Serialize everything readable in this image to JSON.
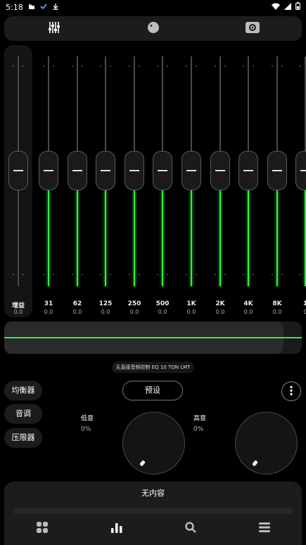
{
  "status_bar": {
    "time": "5:18"
  },
  "gain": {
    "label": "增益",
    "value": "0.0"
  },
  "bands": [
    {
      "freq": "31",
      "value": "0.0"
    },
    {
      "freq": "62",
      "value": "0.0"
    },
    {
      "freq": "125",
      "value": "0.0"
    },
    {
      "freq": "250",
      "value": "0.0"
    },
    {
      "freq": "500",
      "value": "0.0"
    },
    {
      "freq": "1K",
      "value": "0.0"
    },
    {
      "freq": "2K",
      "value": "0.0"
    },
    {
      "freq": "4K",
      "value": "0.0"
    },
    {
      "freq": "8K",
      "value": "0.0"
    },
    {
      "freq": "1",
      "value": "0"
    }
  ],
  "preset_name": "无直接音频控制 EQ 10 TON LMT",
  "side_menu": {
    "equalizer": "均衡器",
    "tone": "音调",
    "limiter": "压限器"
  },
  "preset_button": "预设",
  "bass": {
    "label": "低音",
    "value": "0%"
  },
  "treble": {
    "label": "高音",
    "value": "0%"
  },
  "now_playing": "无内容",
  "colors": {
    "accent": "#2ef23a",
    "background": "#000000",
    "panel": "#1c1c1c"
  },
  "icons": {
    "tab_equalizer": "sliders-icon",
    "tab_tone": "knob-icon",
    "tab_surround": "surround-icon",
    "nav_apps": "grid-icon",
    "nav_eq": "bars-icon",
    "nav_search": "search-icon",
    "nav_menu": "menu-icon"
  }
}
